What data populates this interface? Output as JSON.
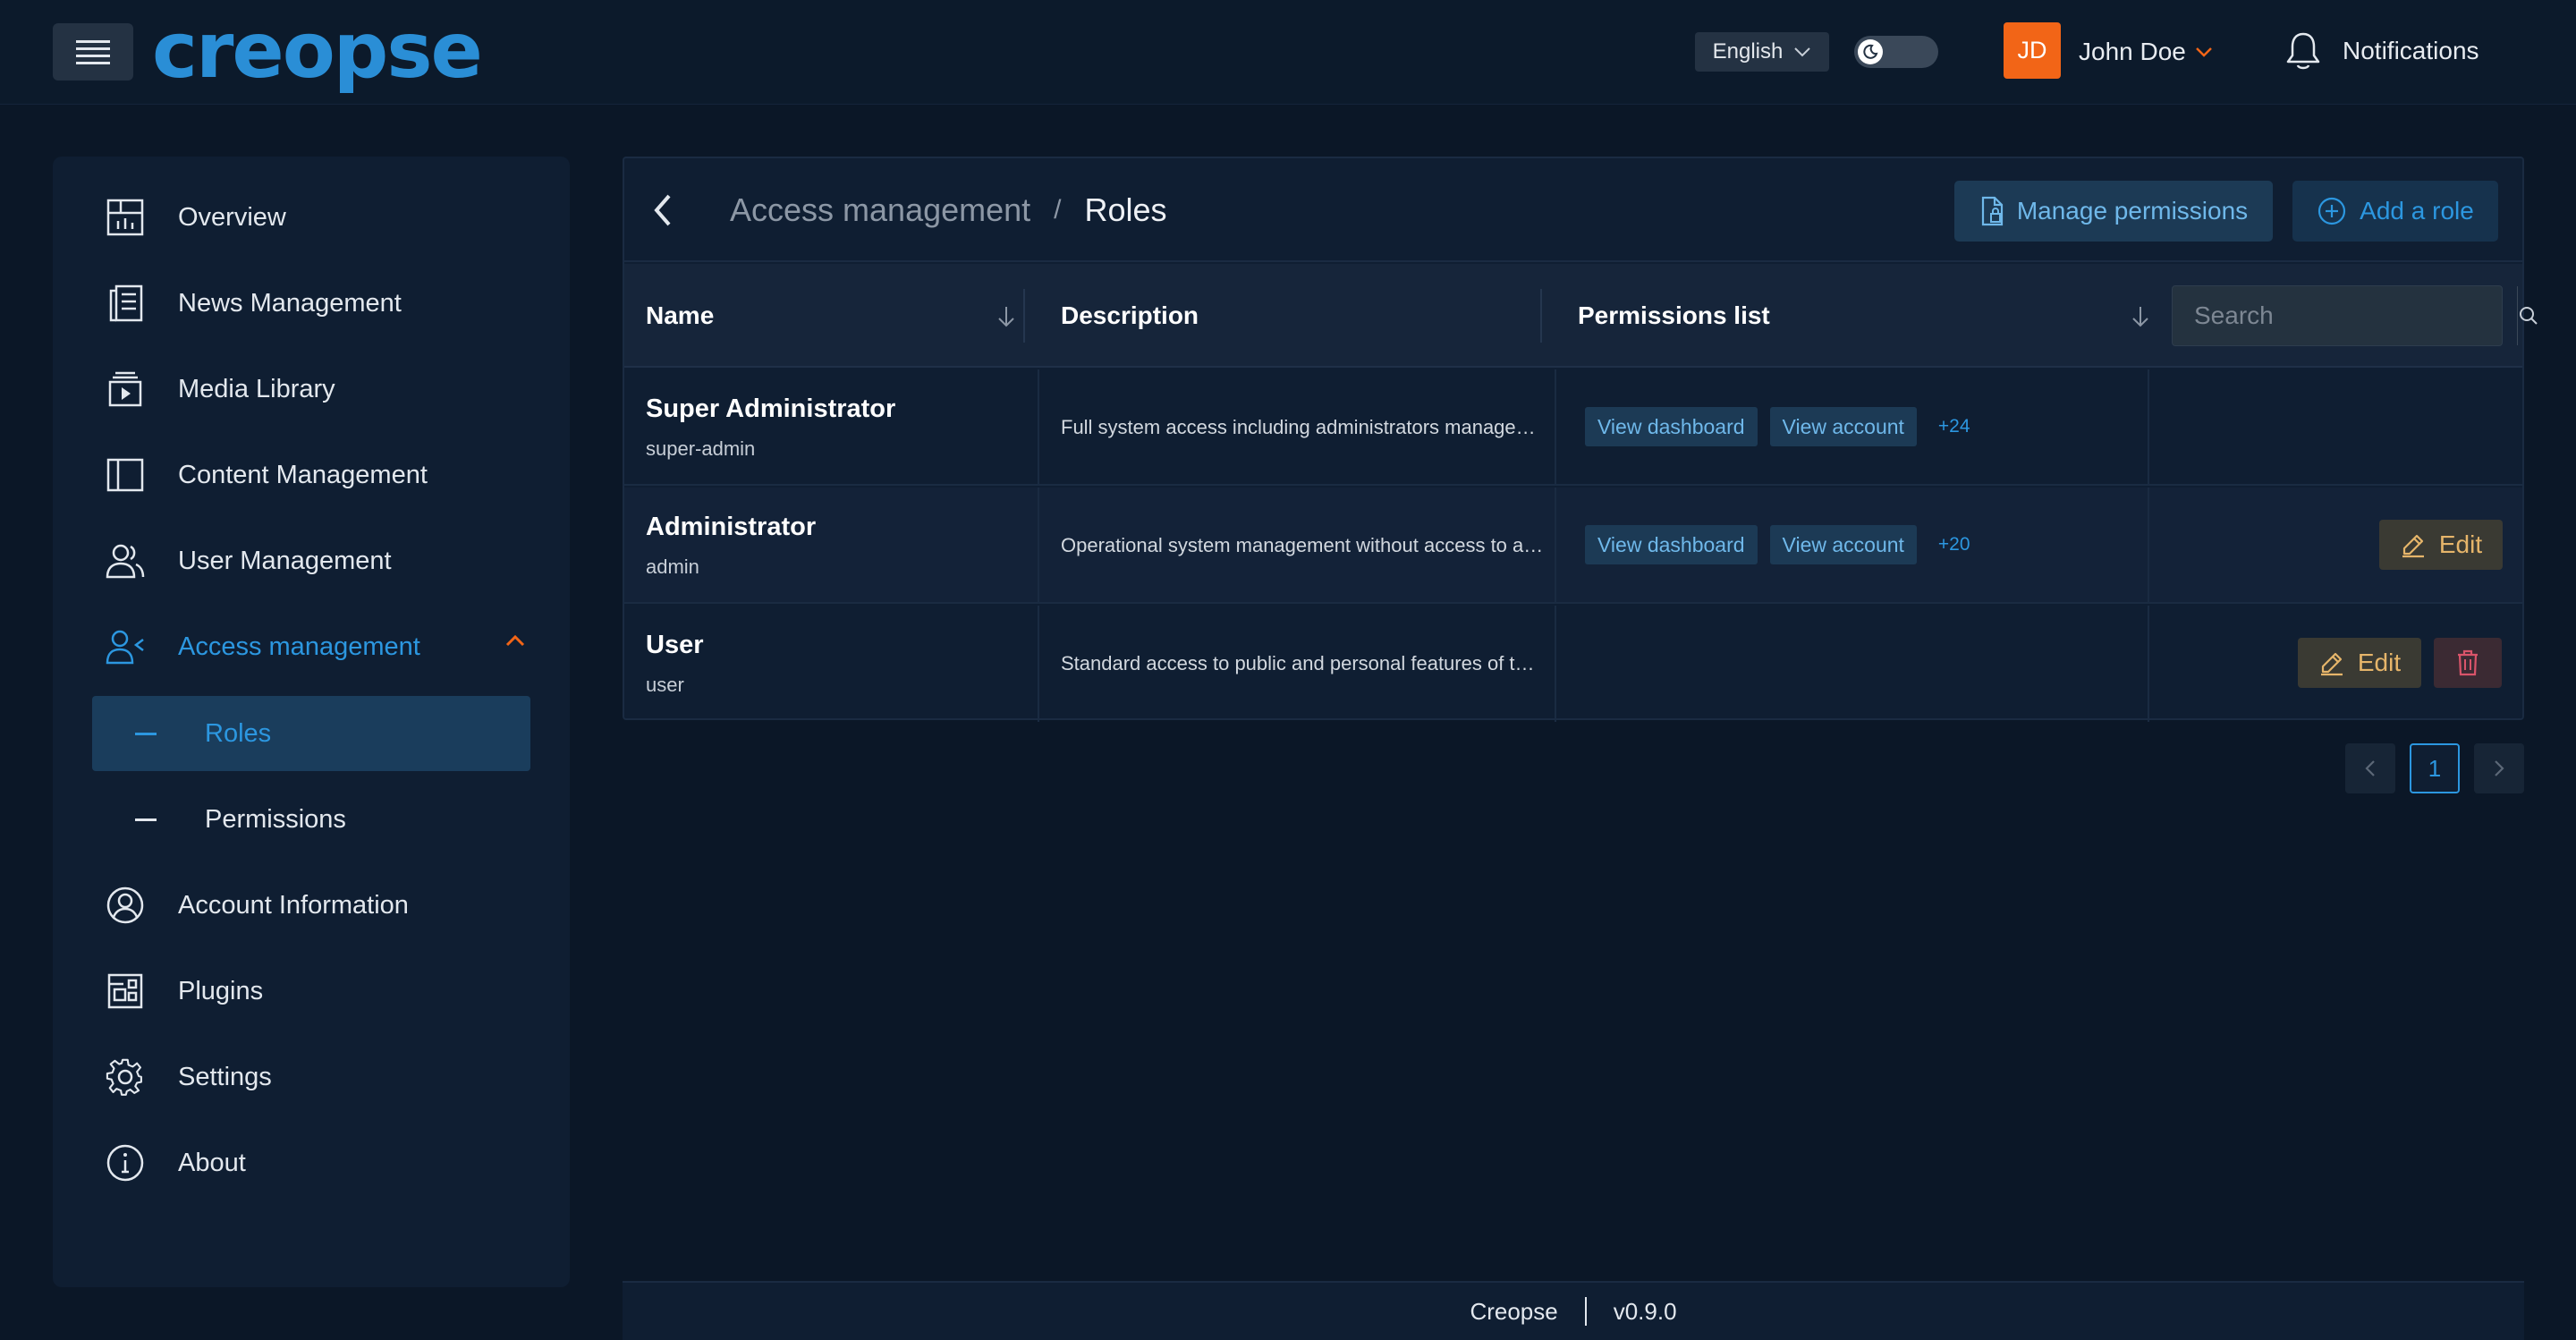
{
  "app": {
    "logo": "creopse"
  },
  "topbar": {
    "language": "English",
    "avatar_initials": "JD",
    "user_name": "John Doe",
    "notifications_label": "Notifications"
  },
  "sidebar": {
    "items": [
      {
        "label": "Overview",
        "icon": "chart-dashboard-icon"
      },
      {
        "label": "News Management",
        "icon": "newspaper-icon"
      },
      {
        "label": "Media Library",
        "icon": "media-library-icon"
      },
      {
        "label": "Content Management",
        "icon": "layout-panel-icon"
      },
      {
        "label": "User Management",
        "icon": "users-icon"
      },
      {
        "label": "Access management",
        "icon": "user-access-icon"
      },
      {
        "label": "Account Information",
        "icon": "user-circle-icon"
      },
      {
        "label": "Plugins",
        "icon": "plugins-icon"
      },
      {
        "label": "Settings",
        "icon": "gear-icon"
      },
      {
        "label": "About",
        "icon": "info-icon"
      }
    ],
    "sub_items": [
      {
        "label": "Roles",
        "active": true
      },
      {
        "label": "Permissions",
        "active": false
      }
    ]
  },
  "header": {
    "breadcrumb_parent": "Access management",
    "breadcrumb_sep": "/",
    "breadcrumb_current": "Roles",
    "manage_permissions": "Manage permissions",
    "add_role": "Add a role"
  },
  "table": {
    "columns": [
      "Name",
      "Description",
      "Permissions list"
    ],
    "search_placeholder": "Search",
    "rows": [
      {
        "name": "Super Administrator",
        "key": "super-admin",
        "description": "Full system access including administrators management",
        "chips": [
          "View dashboard",
          "View account"
        ],
        "more": "+24"
      },
      {
        "name": "Administrator",
        "key": "admin",
        "description": "Operational system management without access to administrators",
        "chips": [
          "View dashboard",
          "View account"
        ],
        "more": "+20",
        "edit": "Edit"
      },
      {
        "name": "User",
        "key": "user",
        "description": "Standard access to public and personal features of the application",
        "chips": [],
        "edit": "Edit"
      }
    ]
  },
  "pagination": {
    "current_page": "1"
  },
  "footer": {
    "app_name": "Creopse",
    "version": "v0.9.0"
  },
  "colors": {
    "accent": "#2c97e0",
    "brand_orange": "#f26517",
    "background": "#0b1727"
  }
}
